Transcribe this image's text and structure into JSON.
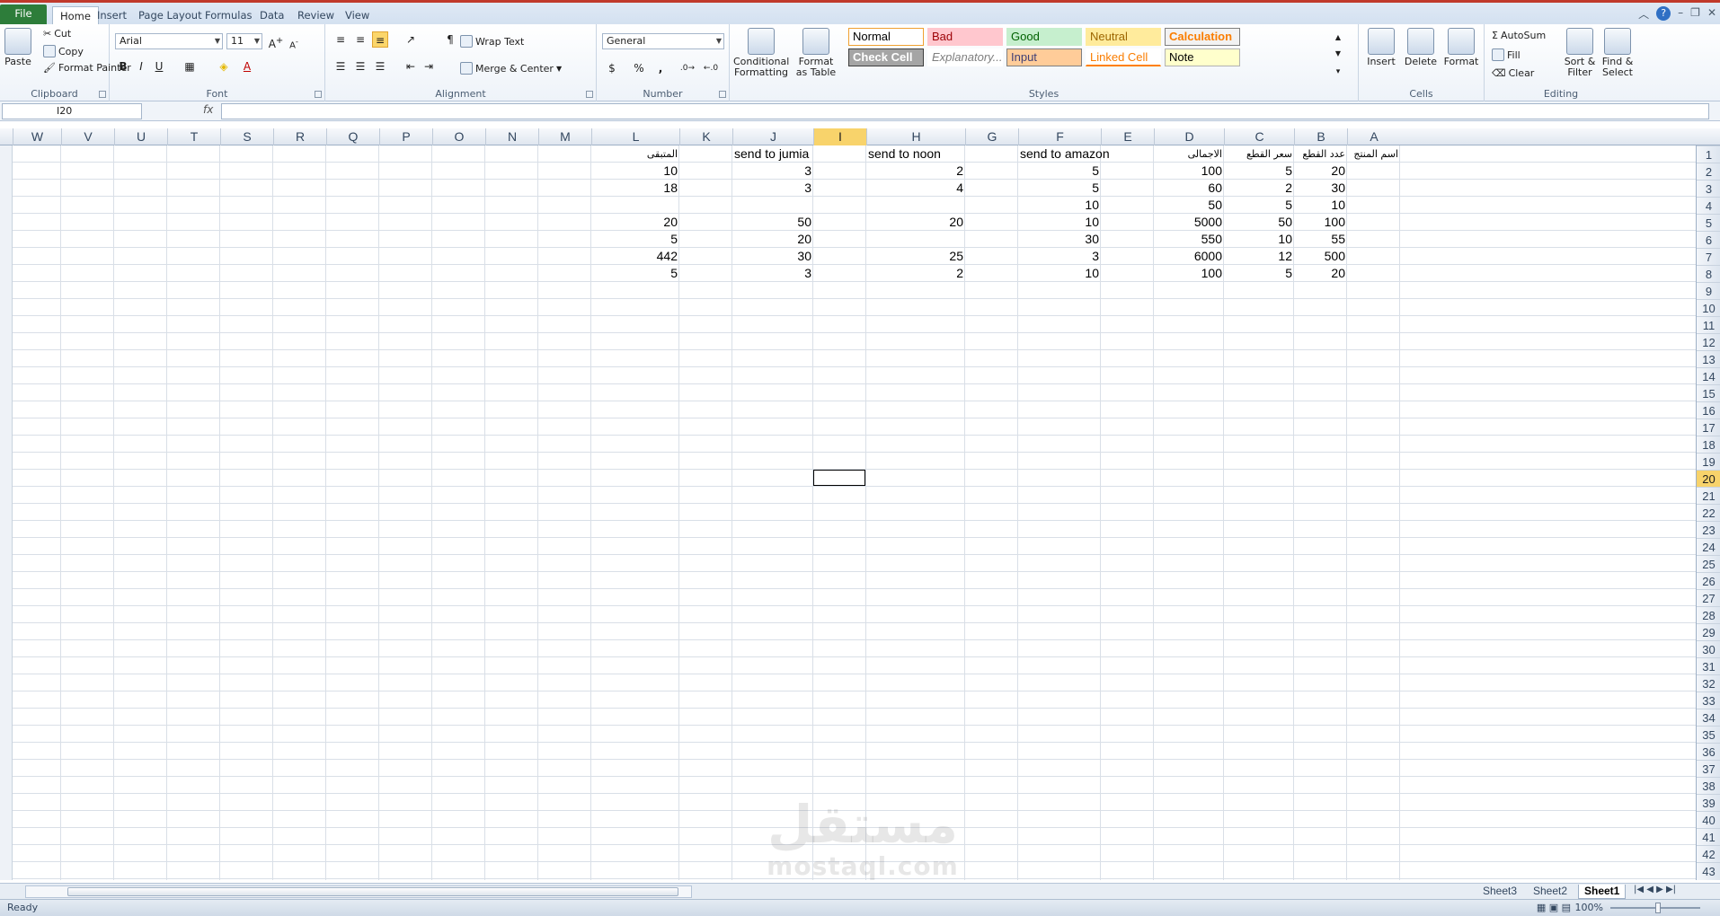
{
  "tabs": [
    "File",
    "Home",
    "Insert",
    "Page Layout",
    "Formulas",
    "Data",
    "Review",
    "View"
  ],
  "active_tab": "Home",
  "clipboard": {
    "paste": "Paste",
    "cut": "Cut",
    "copy": "Copy",
    "format_painter": "Format Painter",
    "label": "Clipboard"
  },
  "font": {
    "name": "Arial",
    "size": "11",
    "label": "Font"
  },
  "alignment": {
    "wrap": "Wrap Text",
    "merge": "Merge & Center",
    "label": "Alignment"
  },
  "number": {
    "format": "General",
    "label": "Number",
    "percent": "%",
    "comma": ","
  },
  "styles": {
    "conditional": "Conditional Formatting",
    "format_table": "Format as Table",
    "label": "Styles",
    "items": [
      {
        "text": "Normal",
        "bg": "#ffffff",
        "fg": "#000000",
        "border": "#f0a030"
      },
      {
        "text": "Bad",
        "bg": "#ffc7ce",
        "fg": "#9c0006",
        "border": "transparent"
      },
      {
        "text": "Good",
        "bg": "#c6efce",
        "fg": "#006100",
        "border": "transparent"
      },
      {
        "text": "Neutral",
        "bg": "#ffeb9c",
        "fg": "#9c6500",
        "border": "transparent"
      },
      {
        "text": "Calculation",
        "bg": "#f2f2f2",
        "fg": "#fa7d00",
        "border": "#7f7f7f"
      },
      {
        "text": "Check Cell",
        "bg": "#a5a5a5",
        "fg": "#ffffff",
        "border": "#3f3f3f"
      },
      {
        "text": "Explanatory...",
        "bg": "#ffffff",
        "fg": "#7f7f7f",
        "border": "transparent"
      },
      {
        "text": "Input",
        "bg": "#ffcc99",
        "fg": "#3f3f76",
        "border": "#7f7f7f"
      },
      {
        "text": "Linked Cell",
        "bg": "#ffffff",
        "fg": "#fa7d00",
        "border": "transparent"
      },
      {
        "text": "Note",
        "bg": "#ffffcc",
        "fg": "#000000",
        "border": "#b2b2b2"
      }
    ]
  },
  "cells_group": {
    "insert": "Insert",
    "delete": "Delete",
    "format": "Format",
    "label": "Cells"
  },
  "editing": {
    "autosum": "AutoSum",
    "fill": "Fill",
    "clear": "Clear",
    "sort": "Sort & Filter",
    "find": "Find & Select",
    "label": "Editing"
  },
  "formula_bar": {
    "name_box": "I20",
    "fx": "fx",
    "formula": ""
  },
  "columns": [
    "W",
    "V",
    "U",
    "T",
    "S",
    "R",
    "Q",
    "P",
    "O",
    "N",
    "M",
    "L",
    "K",
    "J",
    "I",
    "H",
    "G",
    "F",
    "E",
    "D",
    "C",
    "B",
    "A"
  ],
  "selected_column": "I",
  "selected_row": "20",
  "rows": [
    "1",
    "2",
    "3",
    "4",
    "5",
    "6",
    "7",
    "8",
    "9",
    "10",
    "11",
    "12",
    "13",
    "14",
    "15",
    "16",
    "17",
    "18",
    "19",
    "20",
    "21",
    "22",
    "23",
    "24",
    "25",
    "26",
    "27",
    "28",
    "29",
    "30",
    "31",
    "32",
    "33",
    "34",
    "35",
    "36",
    "37",
    "38",
    "39",
    "40",
    "41",
    "42",
    "43"
  ],
  "sheet": {
    "headers": {
      "A": "اسم المنتج",
      "B": "عدد القطع",
      "C": "سعر القطع",
      "D": "الاجمالى",
      "F": "send to amazon",
      "H": "send to noon",
      "J": "send to jumia",
      "L": "المتبقى"
    },
    "data": [
      {
        "B": "20",
        "C": "5",
        "D": "100",
        "F": "5",
        "H": "2",
        "J": "3",
        "L": "10"
      },
      {
        "B": "30",
        "C": "2",
        "D": "60",
        "F": "5",
        "H": "4",
        "J": "3",
        "L": "18"
      },
      {
        "B": "10",
        "C": "5",
        "D": "50",
        "F": "10",
        "H": "",
        "J": "",
        "L": ""
      },
      {
        "B": "100",
        "C": "50",
        "D": "5000",
        "F": "10",
        "H": "20",
        "J": "50",
        "L": "20"
      },
      {
        "B": "55",
        "C": "10",
        "D": "550",
        "F": "30",
        "H": "",
        "J": "20",
        "L": "5"
      },
      {
        "B": "500",
        "C": "12",
        "D": "6000",
        "F": "3",
        "H": "25",
        "J": "30",
        "L": "442"
      },
      {
        "B": "20",
        "C": "5",
        "D": "100",
        "F": "10",
        "H": "2",
        "J": "3",
        "L": "5"
      }
    ]
  },
  "sheet_tabs": [
    "Sheet3",
    "Sheet2",
    "Sheet1"
  ],
  "active_sheet": "Sheet1",
  "status": "Ready",
  "zoom": "100%",
  "watermark": {
    "arabic": "مستقل",
    "latin": "mostaql.com"
  }
}
